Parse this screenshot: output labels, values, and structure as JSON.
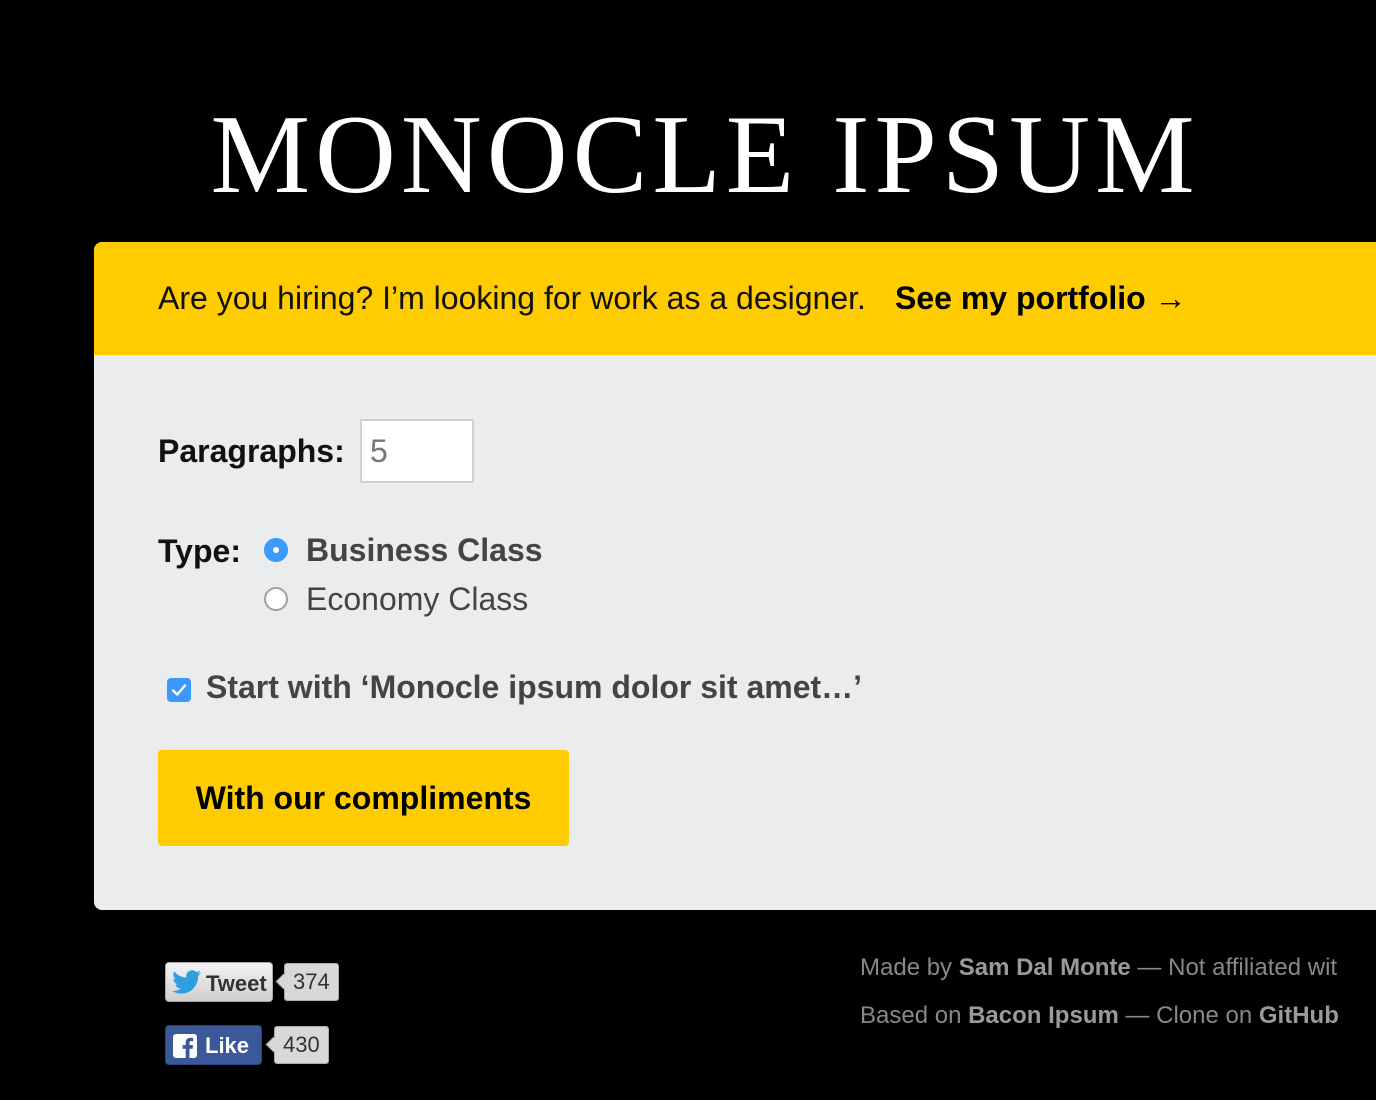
{
  "header": {
    "title": "MONOCLE IPSUM"
  },
  "banner": {
    "text": "Are you hiring? I’m looking for work as a designer.",
    "link_label": "See my portfolio →"
  },
  "form": {
    "paragraphs_label": "Paragraphs:",
    "paragraphs_value": "5",
    "type_label": "Type:",
    "type_options": [
      {
        "label": "Business Class",
        "selected": true
      },
      {
        "label": "Economy Class",
        "selected": false
      }
    ],
    "start_with_label": "Start with ‘Monocle ipsum dolor sit amet…’",
    "start_with_checked": true,
    "submit_label": "With our compliments"
  },
  "social": {
    "tweet_label": "Tweet",
    "tweet_count": "374",
    "like_label": "Like",
    "like_count": "430"
  },
  "footer": {
    "line1": {
      "made_by_prefix": "Made by",
      "author": "Sam Dal Monte",
      "separator": "—",
      "suffix": "Not affiliated wit"
    },
    "line2": {
      "based_prefix": "Based on",
      "based_link": "Bacon Ipsum",
      "separator": "—",
      "clone_prefix": "Clone on",
      "clone_link": "GitHub"
    }
  },
  "colors": {
    "background": "#000000",
    "accent_yellow": "#ffcc00",
    "panel": "#ebeced",
    "control_blue": "#3b99fc",
    "facebook_blue": "#3b5998"
  }
}
